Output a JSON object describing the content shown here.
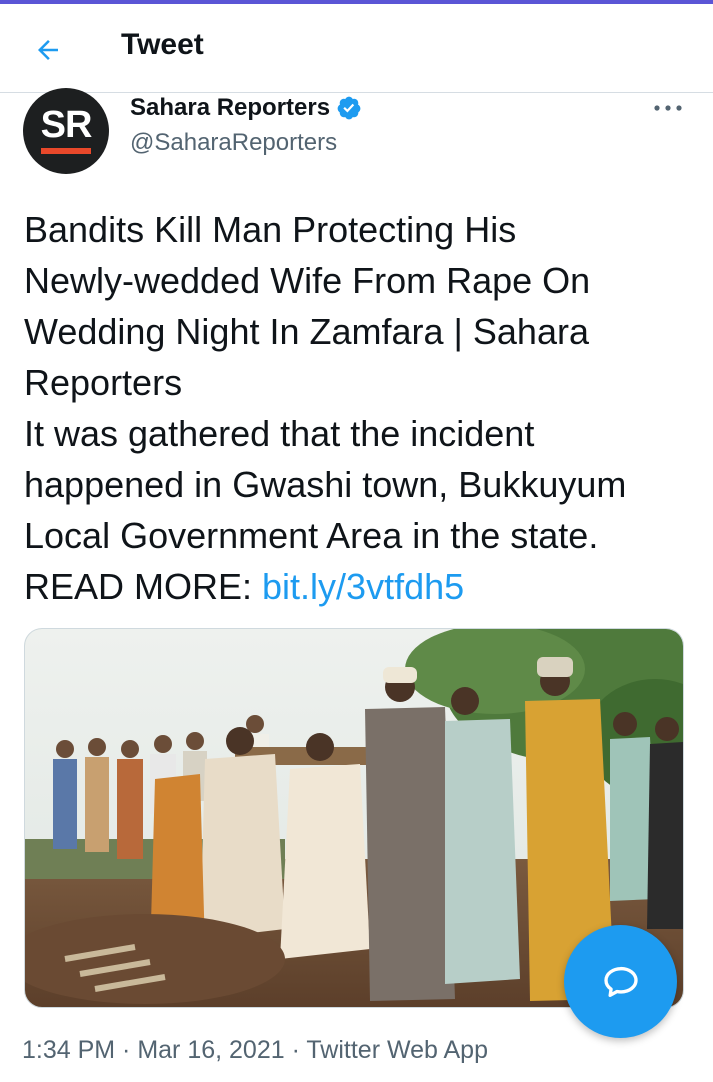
{
  "header": {
    "title": "Tweet"
  },
  "author": {
    "name": "Sahara Reporters",
    "handle": "@SaharaReporters",
    "avatar_text": "SR"
  },
  "tweet": {
    "lines": [
      "Bandits Kill Man Protecting His",
      "Newly-wedded Wife From Rape On",
      "Wedding Night In Zamfara | Sahara",
      "Reporters",
      "It was gathered that the incident",
      "happened in Gwashi town, Bukkuyum",
      "Local Government Area in the state."
    ],
    "read_more_label": "READ MORE: ",
    "link_text": "bit.ly/3vtfdh5"
  },
  "media": {
    "alt": "Men gathered at a burial site"
  },
  "timestamp": "1:34 PM · Mar 16, 2021 · Twitter Web App",
  "icons": {
    "back": "back-arrow-icon",
    "verified": "verified-badge-icon",
    "more": "more-options-icon",
    "compose": "chat-bubble-icon"
  },
  "colors": {
    "accent": "#1d9bf0",
    "text": "#0f1419",
    "secondary": "#536471",
    "brand_bar": "#e8482a"
  }
}
